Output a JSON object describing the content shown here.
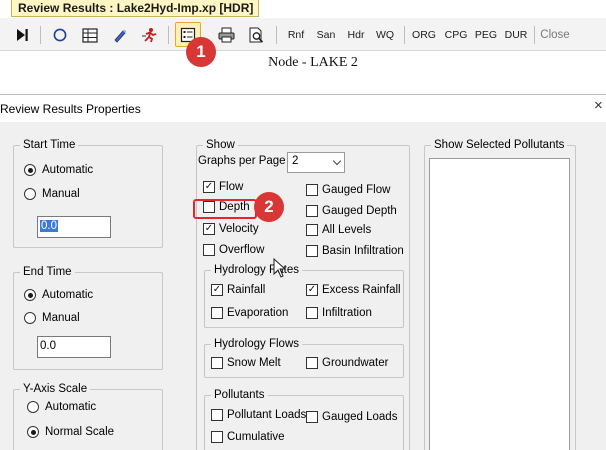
{
  "window": {
    "title": "Review Results : Lake2Hyd-Imp.xp [HDR]"
  },
  "toolbar": {
    "text_buttons": {
      "rnf": "Rnf",
      "san": "San",
      "hdr": "Hdr",
      "wq": "WQ",
      "org": "ORG",
      "cpg": "CPG",
      "peg": "PEG",
      "dur": "DUR",
      "close": "Close"
    },
    "icons": [
      "play-end-icon",
      "circle-icon",
      "list-icon",
      "pen-icon",
      "runner-icon",
      "properties-icon",
      "print-icon",
      "print-preview-icon"
    ]
  },
  "node_title": "Node - LAKE 2",
  "dialog": {
    "title": "Review Results Properties",
    "close": "×",
    "start_time": {
      "legend": "Start Time",
      "automatic": "Automatic",
      "manual": "Manual",
      "value": "0.0",
      "selected": "automatic"
    },
    "end_time": {
      "legend": "End Time",
      "automatic": "Automatic",
      "manual": "Manual",
      "value": "0.0",
      "selected": "automatic"
    },
    "y_axis": {
      "legend": "Y-Axis Scale",
      "automatic": "Automatic",
      "normal": "Normal Scale",
      "selected": "normal"
    },
    "show": {
      "legend": "Show",
      "graphs_per_page_label": "Graphs per Page",
      "graphs_per_page_value": "2",
      "flow": "Flow",
      "depth": "Depth",
      "velocity": "Velocity",
      "overflow": "Overflow",
      "gauged_flow": "Gauged Flow",
      "gauged_depth": "Gauged Depth",
      "all_levels": "All Levels",
      "basin_infiltration": "Basin Infiltration",
      "hydrology_rates": {
        "legend": "Hydrology Rates",
        "rainfall": "Rainfall",
        "excess_rainfall": "Excess Rainfall",
        "evaporation": "Evaporation",
        "infiltration": "Infiltration"
      },
      "hydrology_flows": {
        "legend": "Hydrology Flows",
        "snow_melt": "Snow Melt",
        "groundwater": "Groundwater"
      },
      "pollutants": {
        "legend": "Pollutants",
        "pollutant_loads": "Pollutant Loads",
        "gauged_loads": "Gauged Loads",
        "cumulative": "Cumulative"
      }
    },
    "selected_pollutants": {
      "legend": "Show Selected Pollutants"
    }
  },
  "annotations": {
    "step1": "1",
    "step2": "2"
  },
  "colors": {
    "badge": "#d93636",
    "highlight": "#e02a2a",
    "active_button": "#fff0b8",
    "title_tab": "#fff6c3"
  }
}
